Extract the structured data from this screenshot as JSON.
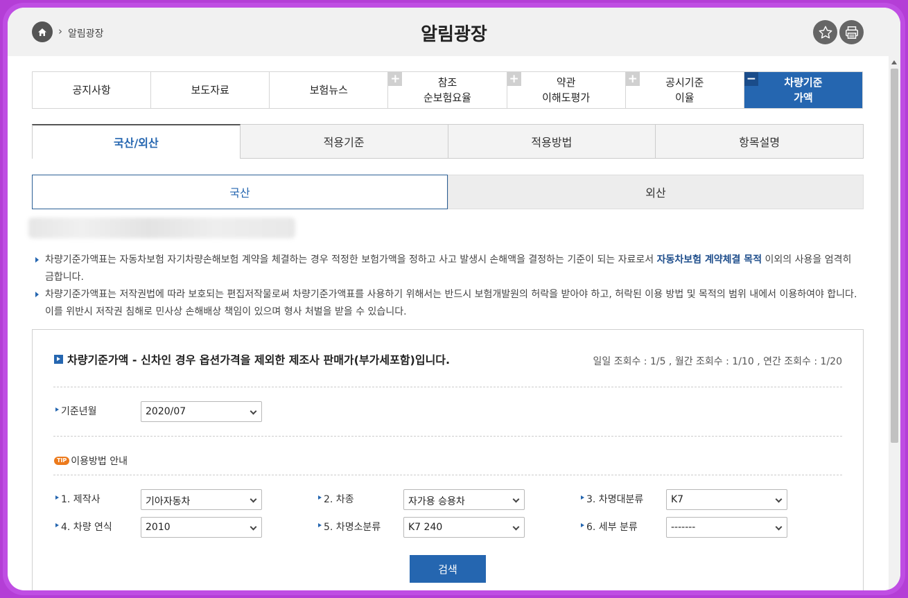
{
  "breadcrumb": {
    "sep": "›",
    "label": "알림광장"
  },
  "page": {
    "title": "알림광장"
  },
  "tabs_top": [
    {
      "label": "공지사항",
      "plus": ""
    },
    {
      "label": "보도자료",
      "plus": ""
    },
    {
      "label": "보험뉴스",
      "plus": ""
    },
    {
      "label_line1": "참조",
      "label_line2": "순보험요율",
      "plus": "+"
    },
    {
      "label_line1": "약관",
      "label_line2": "이해도평가",
      "plus": "+"
    },
    {
      "label_line1": "공시기준",
      "label_line2": "이율",
      "plus": "+"
    },
    {
      "label_line1": "차량기준",
      "label_line2": "가액",
      "plus": "−",
      "active": true
    }
  ],
  "tabs_second": [
    "국산/외산",
    "적용기준",
    "적용방법",
    "항목설명"
  ],
  "tabs_third": [
    "국산",
    "외산"
  ],
  "notice": {
    "item1_pre": "차량기준가액표는 자동차보험 자기차량손해보험 계약을 체결하는 경우 적정한 보험가액을 정하고 사고 발생시 손해액을 결정하는 기준이 되는 자료로서 ",
    "item1_hl": "자동차보험 계약체결 목적",
    "item1_post": " 이외의 사용을 엄격히 금합니다.",
    "item2": "차량기준가액표는 저작권법에 따라 보호되는 편집저작물로써 차량기준가액표를 사용하기 위해서는 반드시 보험개발원의 허락을 받아야 하고, 허락된 이용 방법 및 목적의 범위 내에서 이용하여야 합니다. 이를 위반시 저작권 침해로 민사상 손해배상 책임이 있으며 형사 처벌을 받을 수 있습니다."
  },
  "box": {
    "title": "차량기준가액 - 신차인 경우 옵션가격을 제외한 제조사 판매가(부가세포함)입니다.",
    "counts": "일일 조회수 : 1/5 , 월간 조회수 : 1/10 , 연간 조회수 : 1/20",
    "base_month_label": "기준년월",
    "base_month_value": "2020/07",
    "tip_badge": "TIP",
    "tip_label": "이용방법 안내",
    "fields": [
      {
        "label": "1. 제작사",
        "value": "기아자동차"
      },
      {
        "label": "2. 차종",
        "value": "자가용 승용차"
      },
      {
        "label": "3. 차명대분류",
        "value": "K7"
      },
      {
        "label": "4. 차량 연식",
        "value": "2010"
      },
      {
        "label": "5. 차명소분류",
        "value": "K7 240"
      },
      {
        "label": "6. 세부 분류",
        "value": "-------"
      }
    ],
    "search_label": "검색"
  },
  "colors": {
    "accent": "#2566b0",
    "frame": "#bf4ee3",
    "tip": "#ec7a1c"
  },
  "icons": {
    "home": "home-icon",
    "star": "star-icon",
    "print": "printer-icon"
  }
}
